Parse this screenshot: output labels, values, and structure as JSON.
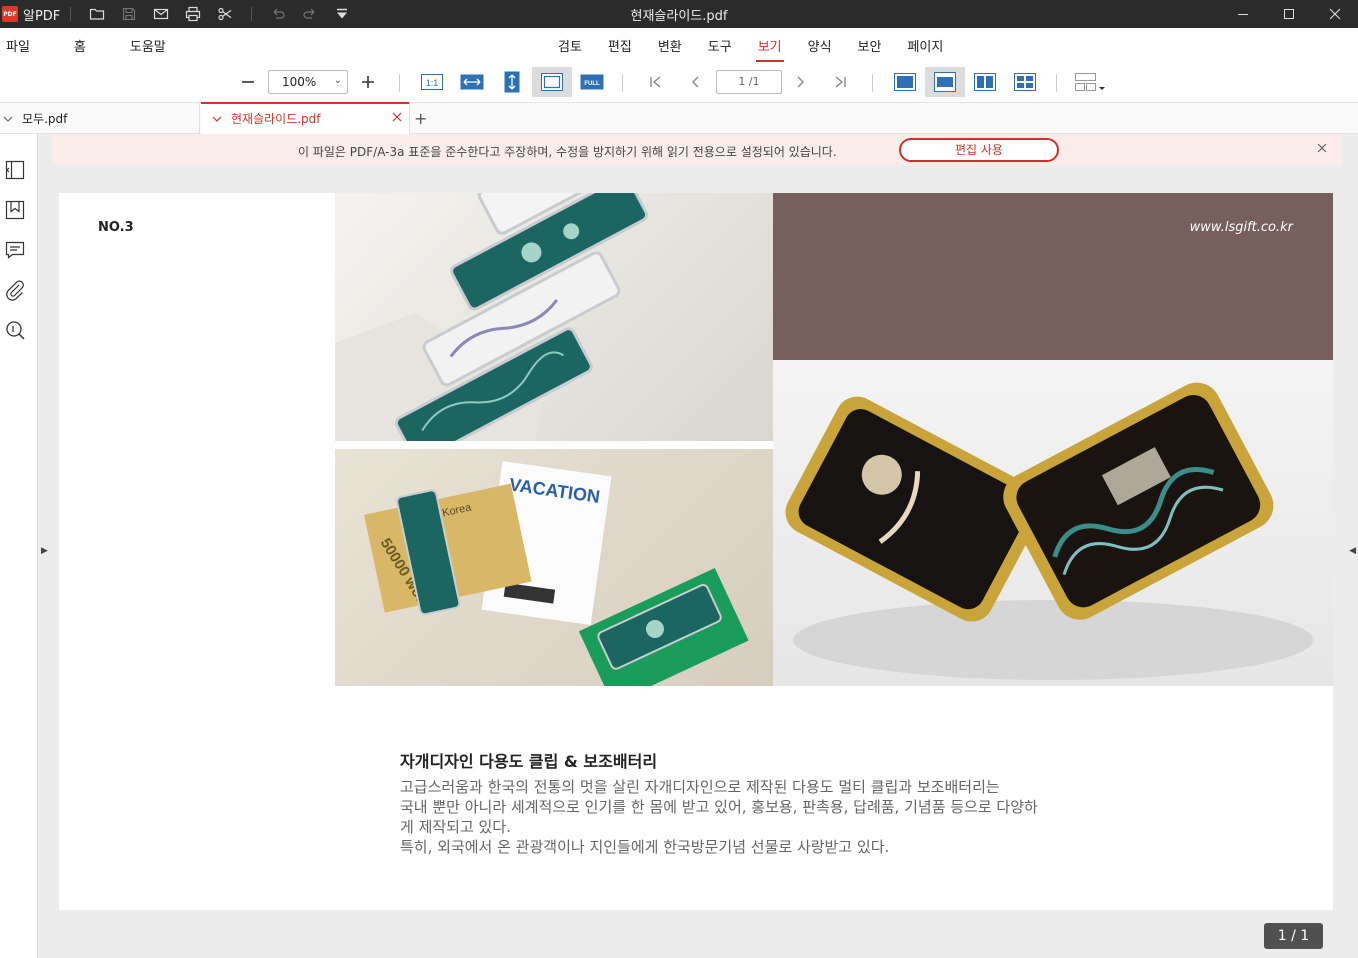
{
  "app": {
    "name": "알PDF",
    "logo_text": "PDF"
  },
  "window": {
    "title": "현재슬라이드.pdf"
  },
  "menu": {
    "left": [
      "파일",
      "홈",
      "도움말"
    ],
    "center": [
      "검토",
      "편집",
      "변환",
      "도구",
      "보기",
      "양식",
      "보안",
      "페이지"
    ],
    "active": "보기"
  },
  "toolbar": {
    "zoom_value": "100%",
    "page_value": "1 /1",
    "actual_size_label": "1:1",
    "full_label": "FULL"
  },
  "tabs": [
    {
      "label": "모두.pdf",
      "active": false
    },
    {
      "label": "현재슬라이드.pdf",
      "active": true
    }
  ],
  "notice": {
    "text": "이 파일은 PDF/A-3a 표준을 준수한다고 주장하며, 수정을 방지하기 위해 읽기 전용으로 설정되어 있습니다.",
    "button_label": "편집 사용"
  },
  "document": {
    "no_label": "NO.3",
    "url": "www.lsgift.co.kr",
    "heading": "자개디자인 다용도 클립 & 보조배터리",
    "body_lines": [
      "고급스러움과 한국의 전통의 멋을 살린 자개디자인으로 제작된 다용도 멀티 클립과 보조배터리는",
      "국내 뿐만 아니라 세계적으로 인기를 한 몸에 받고 있어, 홍보용, 판촉용, 답례품, 기념품 등으로 다양하",
      "게 제작되고 있다.",
      "특히, 외국에서 온 관광객이나 지인들에게 한국방문기념 선물로 사랑받고 있다."
    ],
    "photo_texts": {
      "vacation": "VACATION",
      "banknote": "50000 won",
      "bank": "nk of Korea"
    }
  },
  "page_indicator": "1 / 1",
  "colors": {
    "accent": "#d4302a",
    "titlebar": "#2b2b2b",
    "brown_panel": "#775f5d"
  }
}
